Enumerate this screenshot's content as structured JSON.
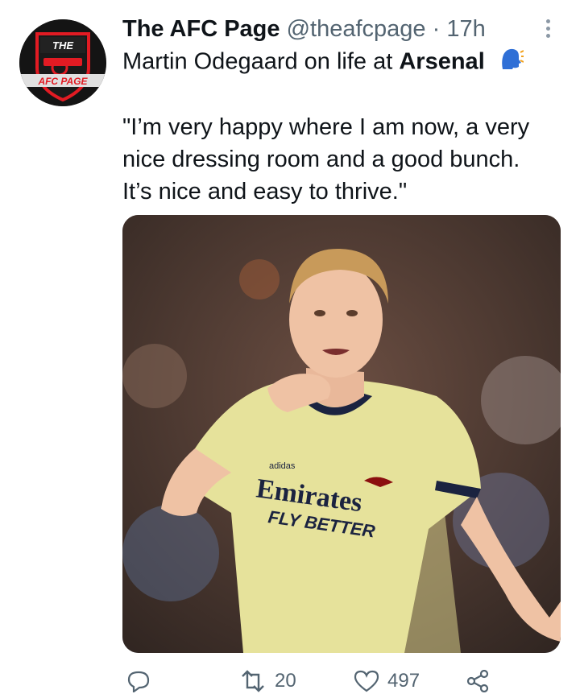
{
  "tweet": {
    "display_name": "The AFC Page",
    "handle": "@theafcpage",
    "separator": "·",
    "time": "17h",
    "intro_text": "Martin Odegaard on life at ",
    "intro_bold": "Arsenal",
    "quote_lines": [
      "\"I’m very happy where I am now, a very",
      "nice dressing room and a good bunch.",
      "It’s nice and easy to thrive.\""
    ]
  },
  "avatar": {
    "logo_text_top": "THE",
    "logo_text_bottom": "AFC PAGE"
  },
  "photo": {
    "sponsor": "Emirates",
    "slogan": "FLY BETTER",
    "brand": "adidas"
  },
  "actions": {
    "reply_count": "",
    "retweet_count": "20",
    "like_count": "497"
  },
  "icons": {
    "reply": "reply-icon",
    "retweet": "retweet-icon",
    "like": "heart-icon",
    "share": "share-icon",
    "more": "more-options-icon",
    "speaking_head": "speaking-head-icon"
  },
  "colors": {
    "text": "#0f1419",
    "secondary": "#536471",
    "kit_yellow": "#e6e29b",
    "kit_navy": "#1b2340",
    "arsenal_red": "#db0007"
  }
}
